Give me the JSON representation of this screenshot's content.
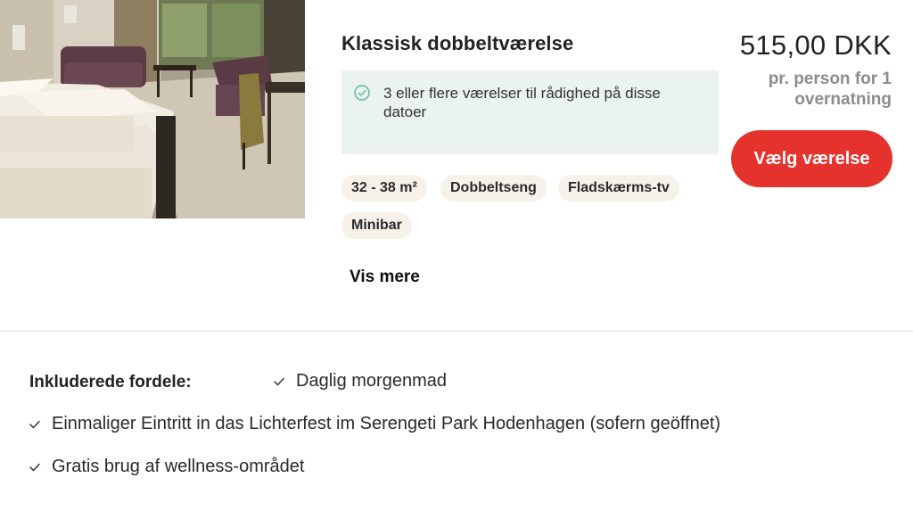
{
  "room": {
    "title": "Klassisk dobbeltværelse",
    "availability_text": "3 eller flere værelser til rådighed på disse datoer",
    "features": [
      "32 - 38 m²",
      "Dobbeltseng",
      "Fladskærms-tv",
      "Minibar"
    ],
    "show_more_label": "Vis mere"
  },
  "pricing": {
    "price": "515,00 DKK",
    "price_note": "pr. person for 1 overnatning",
    "select_button_label": "Vælg værelse"
  },
  "benefits": {
    "heading": "Inkluderede fordele:",
    "items": [
      "Daglig morgenmad",
      "Einmaliger Eintritt in das Lichterfest im Serengeti Park Hodenhagen (sofern geöffnet)",
      "Gratis brug af wellness-området"
    ]
  },
  "colors": {
    "accent": "#e5322d",
    "availability_bg": "#ebf3f1",
    "availability_icon": "#5cb89a",
    "chip_bg": "#f6f2ea",
    "muted_text": "#8c8c8c"
  },
  "icons": {
    "availability": "check-circle-icon",
    "benefit": "checkmark-icon"
  }
}
